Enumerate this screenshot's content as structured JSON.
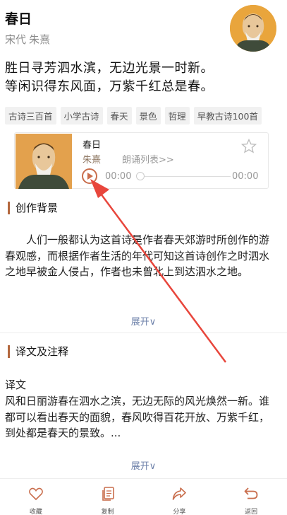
{
  "poem": {
    "title": "春日",
    "dynasty": "宋代",
    "author": "朱熹",
    "lines": [
      "胜日寻芳泗水滨，无边光景一时新。",
      "等闲识得东风面，万紫千红总是春。"
    ]
  },
  "tags": [
    "古诗三百首",
    "小学古诗",
    "春天",
    "景色",
    "哲理",
    "早教古诗100首"
  ],
  "audio": {
    "title": "春日",
    "author": "朱熹",
    "list_link": "朗诵列表>>",
    "time_current": "00:00",
    "time_total": "00:00",
    "progress": 0
  },
  "background": {
    "heading": "创作背景",
    "text": "人们一般都认为这首诗是作者春天郊游时所创作的游春观感，而根据作者生活的年代可知这首诗创作之时泗水之地早被金人侵占，作者也未曾北上到达泗水之地。",
    "expand": "展开∨"
  },
  "translation": {
    "heading": "译文及注释",
    "label": "译文",
    "text": "风和日丽游春在泗水之滨，无边无际的风光焕然一新。谁都可以看出春天的面貌，春风吹得百花开放、万紫千红，到处都是春天的景致。...",
    "expand": "展开∨"
  },
  "bottom_bar": [
    {
      "label": "收藏",
      "icon": "heart-icon"
    },
    {
      "label": "复制",
      "icon": "copy-icon"
    },
    {
      "label": "分享",
      "icon": "share-icon"
    },
    {
      "label": "返回",
      "icon": "back-icon"
    }
  ],
  "colors": {
    "accent": "#b4683f",
    "play": "#c96e4d",
    "link": "#6b7fa8",
    "annotation_arrow": "#e8463c"
  }
}
